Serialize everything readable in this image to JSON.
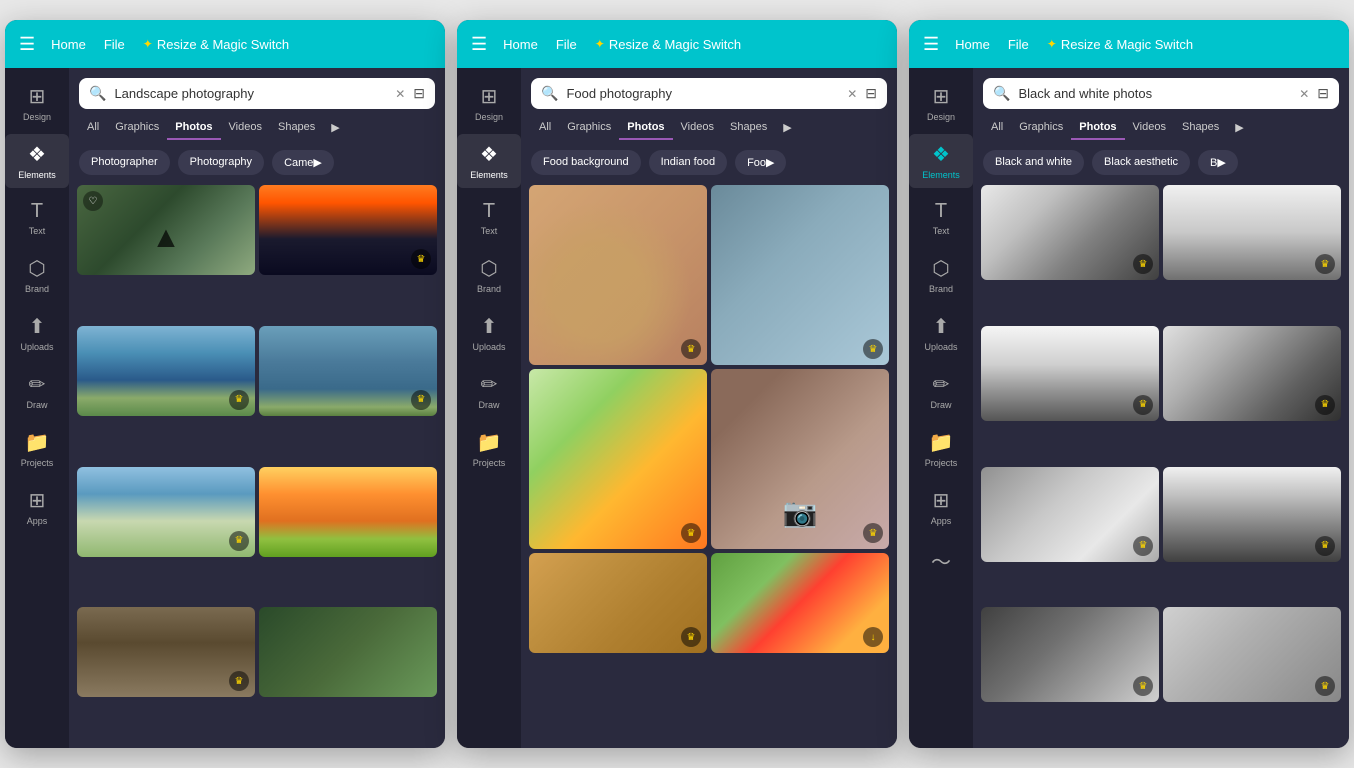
{
  "panels": [
    {
      "id": "landscape",
      "nav": {
        "menu_icon": "☰",
        "links": [
          "Home",
          "File"
        ],
        "magic": "✦ Resize & Magic Switch"
      },
      "search": {
        "placeholder": "Landscape photography",
        "query": "Landscape photography"
      },
      "tabs": [
        "All",
        "Graphics",
        "Photos",
        "Videos",
        "Shapes"
      ],
      "active_tab": "Photos",
      "chips": [
        "Photographer",
        "Photography",
        "Came▶"
      ],
      "sidebar": [
        {
          "icon": "⊞",
          "label": "Design"
        },
        {
          "icon": "✦◆",
          "label": "Elements",
          "active": true
        },
        {
          "icon": "T",
          "label": "Text"
        },
        {
          "icon": "⬡",
          "label": "Brand"
        },
        {
          "icon": "↑",
          "label": "Uploads"
        },
        {
          "icon": "✏",
          "label": "Draw"
        },
        {
          "icon": "📁",
          "label": "Projects"
        },
        {
          "icon": "⊞",
          "label": "Apps"
        }
      ]
    },
    {
      "id": "food",
      "nav": {
        "menu_icon": "☰",
        "links": [
          "Home",
          "File"
        ],
        "magic": "✦ Resize & Magic Switch"
      },
      "search": {
        "placeholder": "Food photography",
        "query": "Food photography"
      },
      "tabs": [
        "All",
        "Graphics",
        "Photos",
        "Videos",
        "Shapes"
      ],
      "active_tab": "Photos",
      "chips": [
        "Food background",
        "Indian food",
        "Foo▶"
      ],
      "sidebar": [
        {
          "icon": "⊞",
          "label": "Design"
        },
        {
          "icon": "✦◆",
          "label": "Elements",
          "active": true
        },
        {
          "icon": "T",
          "label": "Text"
        },
        {
          "icon": "⬡",
          "label": "Brand"
        },
        {
          "icon": "↑",
          "label": "Uploads"
        },
        {
          "icon": "✏",
          "label": "Draw"
        },
        {
          "icon": "📁",
          "label": "Projects"
        }
      ]
    },
    {
      "id": "bw",
      "nav": {
        "menu_icon": "☰",
        "links": [
          "Home",
          "File"
        ],
        "magic": "✦ Resize & Magic Switch"
      },
      "search": {
        "placeholder": "Black and white photos",
        "query": "Black and white photos"
      },
      "tabs": [
        "All",
        "Graphics",
        "Photos",
        "Videos",
        "Shapes"
      ],
      "active_tab": "Photos",
      "chips": [
        "Black and white",
        "Black aesthetic",
        "B▶"
      ],
      "sidebar": [
        {
          "icon": "⊞",
          "label": "Design"
        },
        {
          "icon": "✦◆",
          "label": "Elements",
          "active": true
        },
        {
          "icon": "T",
          "label": "Text"
        },
        {
          "icon": "⬡",
          "label": "Brand"
        },
        {
          "icon": "↑",
          "label": "Uploads"
        },
        {
          "icon": "✏",
          "label": "Draw"
        },
        {
          "icon": "📁",
          "label": "Projects"
        },
        {
          "icon": "⊞",
          "label": "Apps"
        },
        {
          "icon": "〜",
          "label": ""
        }
      ]
    }
  ],
  "crown_icon": "♛",
  "heart_icon": "♡",
  "clear_icon": "✕",
  "filter_icon": "⊟",
  "more_icon": "▶"
}
